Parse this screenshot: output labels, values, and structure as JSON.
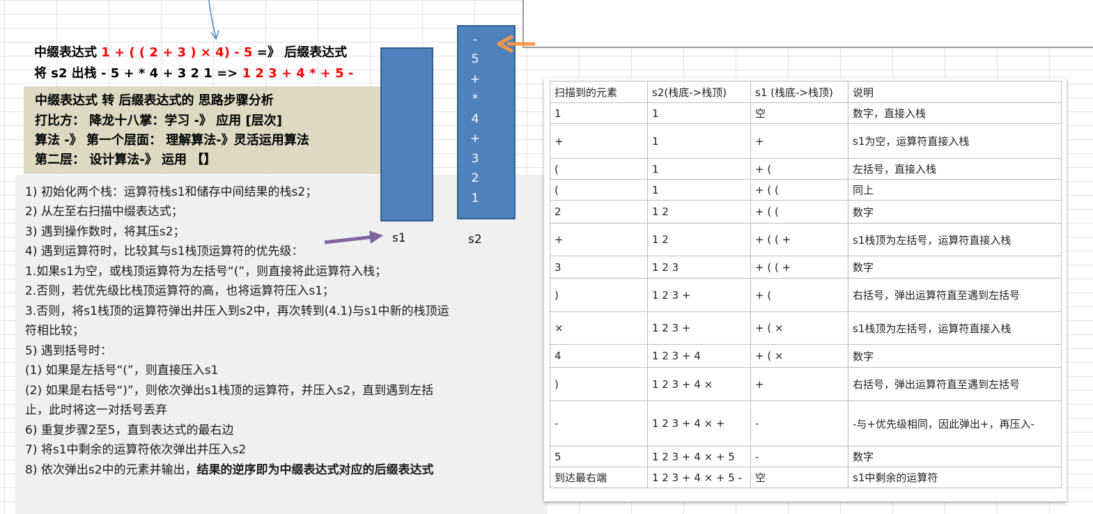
{
  "header": {
    "line1_prefix": "中缀表达式",
    "line1_expr": "1 + ( ( 2 + 3 ) × 4) - 5",
    "line1_mid": "=》 后缀表达式",
    "line2_prefix": "将 s2 出栈  - 5 + * 4 + 3 2 1  =>",
    "line2_result": "1 2 3 + 4 * + 5 -"
  },
  "analysis": {
    "lines": [
      "中缀表达式 转 后缀表达式的 思路步骤分析",
      "打比方：  降龙十八掌：学习 -》 应用 [层次]",
      "算法 -》 第一个层面：  理解算法-》灵活运用算法",
      "第二层：  设计算法-》 运用 【】"
    ]
  },
  "steps": {
    "lines": [
      "1) 初始化两个栈：运算符栈s1和储存中间结果的栈s2；",
      "2) 从左至右扫描中缀表达式；",
      "3) 遇到操作数时，将其压s2；",
      "4) 遇到运算符时，比较其与s1栈顶运算符的优先级：",
      "1.如果s1为空，或栈顶运算符为左括号“(”，则直接将此运算符入栈；",
      "2.否则，若优先级比栈顶运算符的高，也将运算符压入s1；",
      "3.否则，将s1栈顶的运算符弹出并压入到s2中，再次转到(4.1)与s1中新的栈顶运",
      "符相比较；",
      "5) 遇到括号时：",
      "(1) 如果是左括号“(”，则直接压入s1",
      "(2) 如果是右括号“)”，则依次弹出s1栈顶的运算符，并压入s2，直到遇到左括",
      "止，此时将这一对括号丢弃",
      "6) 重复步骤2至5，直到表达式的最右边",
      "7) 将s1中剩余的运算符依次弹出并压入s2"
    ],
    "last_prefix": "8)  依次弹出s2中的元素并输出，",
    "last_bold": "结果的逆序即为中缀表达式对应的后缀表达式"
  },
  "stacks": {
    "s1_label": "s1",
    "s2_label": "s2",
    "s2_items": [
      "-",
      "5",
      "+",
      "*",
      "4",
      "+",
      "3",
      "2",
      "1"
    ]
  },
  "table": {
    "headers": [
      "扫描到的元素",
      "s2(栈底->栈顶)",
      "s1 (栈底->栈顶)",
      "说明"
    ],
    "rows": [
      [
        "1",
        "1",
        "空",
        "数字，直接入栈"
      ],
      [
        "+",
        "1",
        "+",
        "s1为空，运算符直接入栈"
      ],
      [
        "(",
        "1",
        "+ (",
        "左括号，直接入栈"
      ],
      [
        "(",
        "1",
        "+ ( (",
        "同上"
      ],
      [
        "2",
        "1 2",
        "+ ( (",
        "数字"
      ],
      [
        "+",
        "1 2",
        "+ ( ( +",
        "s1栈顶为左括号，运算符直接入栈"
      ],
      [
        "3",
        "1 2 3",
        "+ ( ( +",
        "数字"
      ],
      [
        ")",
        "1 2 3 +",
        "+ (",
        "右括号，弹出运算符直至遇到左括号"
      ],
      [
        "×",
        "1 2 3 +",
        "+ ( ×",
        "s1栈顶为左括号，运算符直接入栈"
      ],
      [
        "4",
        "1 2 3 + 4",
        "+ ( ×",
        "数字"
      ],
      [
        ")",
        "1 2 3 + 4 ×",
        "+",
        "右括号，弹出运算符直至遇到左括号"
      ],
      [
        "-",
        "1 2 3 + 4 × +",
        "-",
        "-与+优先级相同，因此弹出+，再压入-"
      ],
      [
        "5",
        "1 2 3 + 4 × + 5",
        "-",
        "数字"
      ],
      [
        "到达最右端",
        "1 2 3 + 4 × + 5 -",
        "空",
        "s1中剩余的运算符"
      ]
    ]
  },
  "colors": {
    "stack_fill": "#4f81bd",
    "tan_box": "#ddd9c3",
    "gray_box": "#f0f0f0",
    "highlight_red": "#ff0000",
    "arrow_orange": "#f79646",
    "arrow_purple": "#8064a2",
    "arrow_blue": "#4a7ebb"
  }
}
